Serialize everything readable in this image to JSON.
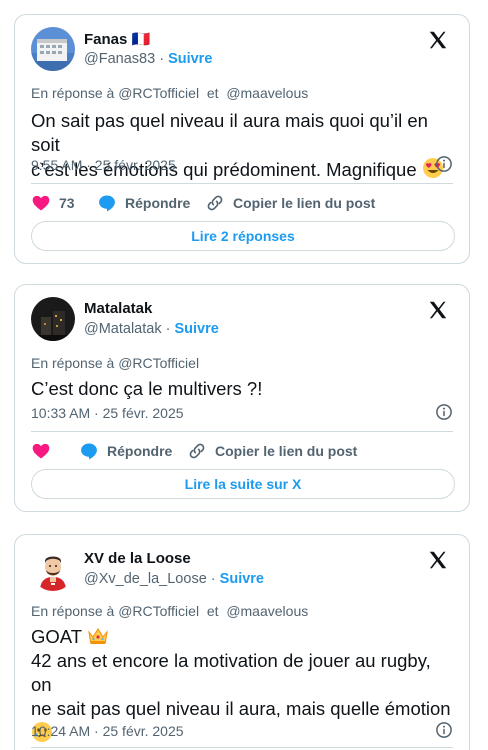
{
  "posts": [
    {
      "author": "Fanas 🇫🇷",
      "handle": "@Fanas83",
      "follow": "Suivre",
      "reply_prefix": "En réponse à",
      "reply_to_1": "@RCTofficiel",
      "reply_and": "et",
      "reply_to_2": "@maavelous",
      "text_line1": "On sait pas quel niveau il aura mais quoi qu’il en soit",
      "text_line2": "c’est les émotions qui prédominent. Magnifique",
      "timestamp": "9:55 AM · 25 févr. 2025",
      "likes": "73",
      "reply_label": "Répondre",
      "copy_label": "Copier le lien du post",
      "read_button": "Lire 2 réponses"
    },
    {
      "author": "Matalatak",
      "handle": "@Matalatak",
      "follow": "Suivre",
      "reply_prefix": "En réponse à",
      "reply_to_1": "@RCTofficiel",
      "text_line1": "C’est donc ça le multivers ?!",
      "timestamp": "10:33 AM · 25 févr. 2025",
      "reply_label": "Répondre",
      "copy_label": "Copier le lien du post",
      "read_button": "Lire la suite sur X"
    },
    {
      "author": "XV de la Loose",
      "handle": "@Xv_de_la_Loose",
      "follow": "Suivre",
      "reply_prefix": "En réponse à",
      "reply_to_1": "@RCTofficiel",
      "reply_and": "et",
      "reply_to_2": "@maavelous",
      "text_line1": "GOAT",
      "text_line2": "42 ans et encore la motivation de jouer au rugby, on",
      "text_line3": "ne sait pas quel niveau il aura, mais quelle émotion",
      "timestamp": "10:24 AM · 25 févr. 2025"
    }
  ],
  "icons": {
    "brand": "x-logo-icon",
    "info": "info-icon",
    "like": "heart-icon",
    "reply": "speech-bubble-icon",
    "copy": "link-icon"
  },
  "colors": {
    "accent": "#1d9bf0",
    "like": "#f91880",
    "muted": "#536471",
    "border": "#cfd9de"
  }
}
